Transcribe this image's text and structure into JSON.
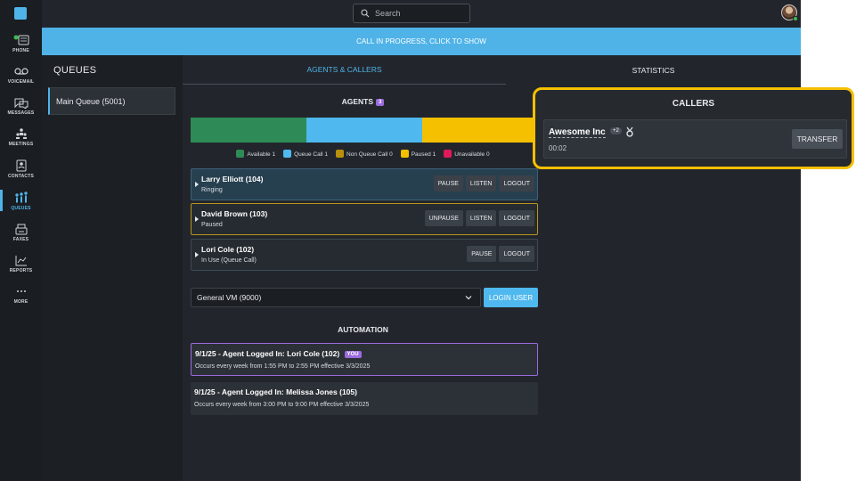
{
  "colors": {
    "accent": "#4fb3e8",
    "available": "#2e8b57",
    "queue_call": "#4fb8ee",
    "non_queue_call": "#b8900a",
    "paused": "#f5c000",
    "unavailable": "#e0195a",
    "highlight": "#f5c000"
  },
  "nav": {
    "items": [
      {
        "label": "PHONE",
        "icon": "phone-icon"
      },
      {
        "label": "VOICEMAIL",
        "icon": "voicemail-icon"
      },
      {
        "label": "MESSAGES",
        "icon": "messages-icon"
      },
      {
        "label": "MEETINGS",
        "icon": "meetings-icon"
      },
      {
        "label": "CONTACTS",
        "icon": "contacts-icon"
      },
      {
        "label": "QUEUES",
        "icon": "queues-icon"
      },
      {
        "label": "FAXES",
        "icon": "fax-icon"
      },
      {
        "label": "REPORTS",
        "icon": "reports-icon"
      },
      {
        "label": "MORE",
        "icon": "more-icon"
      }
    ],
    "active": "QUEUES"
  },
  "search": {
    "placeholder": "Search"
  },
  "banner": {
    "text": "CALL IN PROGRESS, CLICK TO SHOW"
  },
  "queues": {
    "title": "QUEUES",
    "items": [
      {
        "label": "Main Queue (5001)"
      }
    ]
  },
  "tabs": {
    "agents": "AGENTS & CALLERS",
    "statistics": "STATISTICS"
  },
  "agents": {
    "title": "AGENTS",
    "count": "3",
    "distribution": {
      "available": 1,
      "queue_call": 1,
      "non_queue_call": 0,
      "paused": 1,
      "unavailable": 0
    },
    "legend": [
      {
        "label": "Available 1",
        "color": "#2e8b57"
      },
      {
        "label": "Queue Call 1",
        "color": "#4fb8ee"
      },
      {
        "label": "Non Queue Call 0",
        "color": "#b8900a"
      },
      {
        "label": "Paused 1",
        "color": "#f5c000"
      },
      {
        "label": "Unavailable 0",
        "color": "#e0195a"
      }
    ],
    "list": [
      {
        "name": "Larry Elliott (104)",
        "state": "Ringing",
        "buttons": [
          "PAUSE",
          "LISTEN",
          "LOGOUT"
        ]
      },
      {
        "name": "David Brown (103)",
        "state": "Paused",
        "buttons": [
          "UNPAUSE",
          "LISTEN",
          "LOGOUT"
        ]
      },
      {
        "name": "Lori Cole (102)",
        "state": "In Use (Queue Call)",
        "buttons": [
          "PAUSE",
          "LOGOUT"
        ]
      }
    ]
  },
  "login": {
    "selected": "General VM (9000)",
    "button": "LOGIN USER"
  },
  "automation": {
    "title": "AUTOMATION",
    "items": [
      {
        "title": "9/1/25 - Agent Logged In: Lori Cole (102)",
        "badge": "YOU",
        "detail": "Occurs every week from 1:55 PM to 2:55 PM effective 3/3/2025"
      },
      {
        "title": "9/1/25 - Agent Logged In: Melissa Jones (105)",
        "detail": "Occurs every week from 3:00 PM to 9:00 PM effective 3/3/2025"
      }
    ]
  },
  "callers": {
    "title": "CALLERS",
    "items": [
      {
        "name": "Awesome Inc",
        "extra": "+2",
        "time": "00:02",
        "button": "TRANSFER"
      }
    ]
  }
}
